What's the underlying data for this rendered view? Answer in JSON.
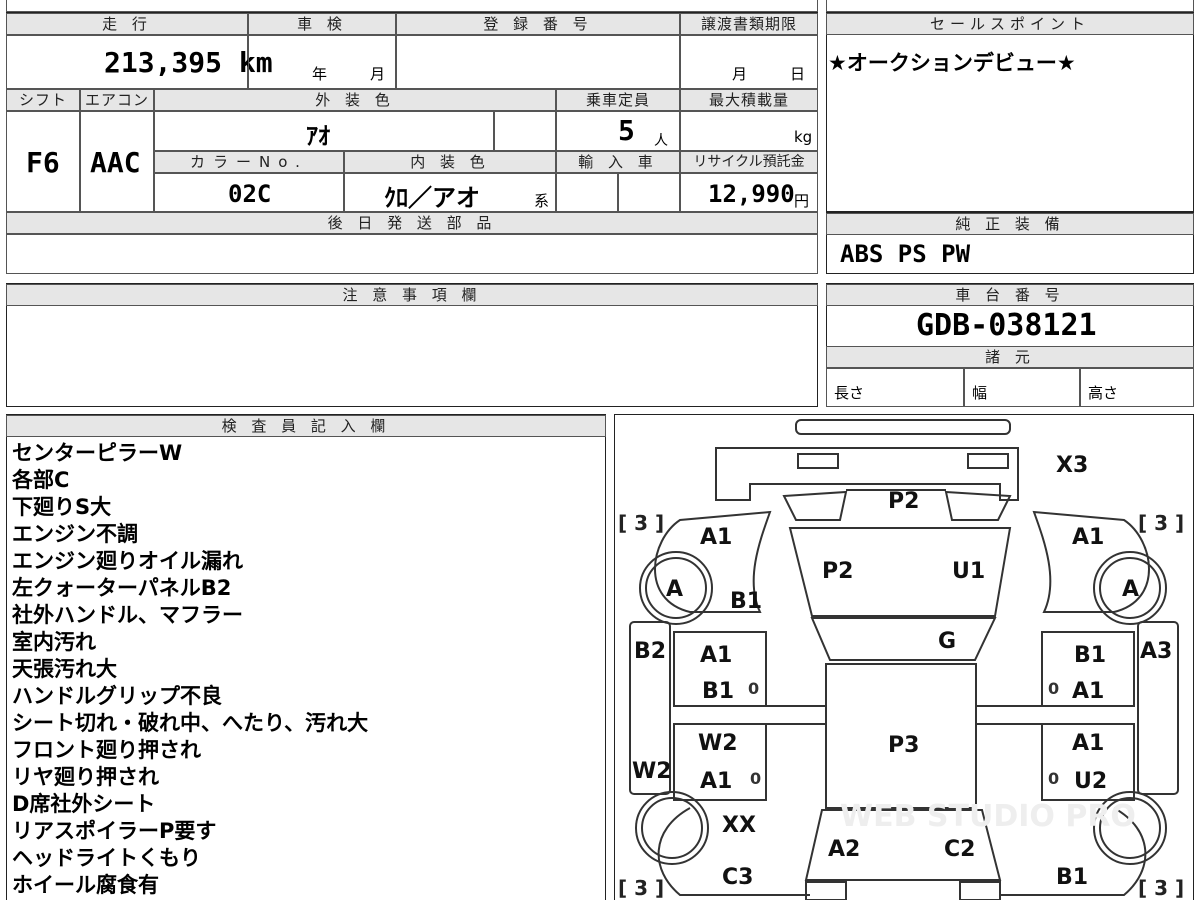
{
  "sheet": {
    "mileage": {
      "header": "走 行",
      "value": "213,395 km"
    },
    "shaken": {
      "header": "車 検",
      "year_unit": "年",
      "month_unit": "月"
    },
    "registration": {
      "header": "登 録 番 号",
      "value": ""
    },
    "transfer_deadline": {
      "header": "譲渡書類期限",
      "month_unit": "月",
      "day_unit": "日"
    },
    "sales_point": {
      "header": "セールスポイント",
      "text": "★オークションデビュー★"
    },
    "shift": {
      "header": "シフト",
      "value": "F6"
    },
    "aircon": {
      "header": "エアコン",
      "value": "AAC"
    },
    "exterior_color": {
      "header": "外 装 色",
      "value": "ｱｵ"
    },
    "capacity": {
      "header": "乗車定員",
      "value": "5",
      "unit": "人"
    },
    "max_load": {
      "header": "最大積載量",
      "value": "",
      "unit": "kg"
    },
    "color_no": {
      "header": "カラーNo.",
      "value": "02C"
    },
    "interior_color": {
      "header": "内 装 色",
      "value": "ｸﾛ／アオ",
      "suffix": "系"
    },
    "import": {
      "header": "輸 入 車",
      "value": ""
    },
    "recycle": {
      "header": "リサイクル預託金",
      "value": "12,990",
      "unit": "円"
    },
    "later_parts": {
      "header": "後 日 発 送 部 品",
      "value": ""
    },
    "genuine_equipment": {
      "header": "純 正 装 備",
      "value": "ABS PS PW"
    },
    "caution": {
      "header": "注 意 事 項 欄",
      "value": ""
    },
    "chassis_no": {
      "header": "車 台 番 号",
      "value": "GDB-038121"
    },
    "specs": {
      "header": "諸 元",
      "length": "長さ",
      "width": "幅",
      "height": "高さ"
    },
    "inspector": {
      "header": "検 査 員 記 入 欄",
      "notes": [
        "センターピラーW",
        "各部C",
        "下廻りS大",
        "エンジン不調",
        "エンジン廻りオイル漏れ",
        "左クォーターパネルB2",
        "社外ハンドル、マフラー",
        "室内汚れ",
        "天張汚れ大",
        "ハンドルグリップ不良",
        "シート切れ・破れ中、へたり、汚れ大",
        "フロント廻り押され",
        "リヤ廻り押され",
        "D席社外シート",
        "リアスポイラーP要す",
        "ヘッドライトくもり",
        "ホイール腐食有"
      ]
    }
  },
  "diagram": {
    "tire_tread": "3",
    "tire_labels": {
      "front_left": "A",
      "front_right": "A"
    },
    "marks": {
      "rear_spoiler": "X3",
      "rear_glass": "P2",
      "trunk_left": "A1",
      "trunk_right": "A1",
      "rear_fender_left": "B1",
      "rear_window": "P2",
      "roof_right": "U1",
      "roof_center": "G",
      "left_side_outer_top": "B2",
      "left_door_rear_1": "A1",
      "left_door_rear_2": "B1",
      "left_door_front_1": "W2",
      "left_door_front_2": "A1",
      "left_side_outer_bottom": "W2",
      "right_side_outer": "A3",
      "right_door_rear_1": "B1",
      "right_door_rear_2": "A1",
      "right_door_front_1": "A1",
      "right_door_front_2": "U2",
      "cabin": "P3",
      "front_fender_left": "XX",
      "hood_left": "A2",
      "hood_right": "C2",
      "front_left_low": "C3",
      "front_right_low": "B1",
      "small_zero": "0"
    },
    "watermark": "WEB STUDIO PRO"
  }
}
